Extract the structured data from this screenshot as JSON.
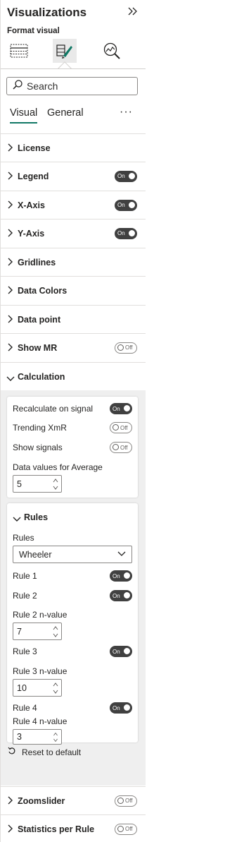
{
  "header": {
    "title": "Visualizations",
    "subtitle": "Format visual",
    "icons": [
      "table-icon",
      "format-paintbrush-icon",
      "analytics-icon"
    ]
  },
  "search": {
    "placeholder": "Search"
  },
  "tabs": {
    "visual": "Visual",
    "general": "General",
    "more": "···"
  },
  "sections": {
    "license": {
      "label": "License"
    },
    "legend": {
      "label": "Legend",
      "toggle": "On"
    },
    "xaxis": {
      "label": "X-Axis",
      "toggle": "On"
    },
    "yaxis": {
      "label": "Y-Axis",
      "toggle": "On"
    },
    "gridlines": {
      "label": "Gridlines"
    },
    "datacolors": {
      "label": "Data Colors"
    },
    "datapoint": {
      "label": "Data point"
    },
    "showmr": {
      "label": "Show MR",
      "toggle": "Off"
    },
    "calculation": {
      "label": "Calculation"
    }
  },
  "calculation": {
    "recalc": {
      "label": "Recalculate on signal",
      "toggle": "On"
    },
    "trending": {
      "label": "Trending XmR",
      "toggle": "Off"
    },
    "signals": {
      "label": "Show signals",
      "toggle": "Off"
    },
    "average": {
      "label": "Data values for Average",
      "value": "5"
    }
  },
  "rules": {
    "header": "Rules",
    "dropdown_label": "Rules",
    "dropdown_value": "Wheeler",
    "rule1": {
      "label": "Rule 1",
      "toggle": "On"
    },
    "rule2": {
      "label": "Rule 2",
      "toggle": "On"
    },
    "rule2n": {
      "label": "Rule 2 n-value",
      "value": "7"
    },
    "rule3": {
      "label": "Rule 3",
      "toggle": "On"
    },
    "rule3n": {
      "label": "Rule 3 n-value",
      "value": "10"
    },
    "rule4": {
      "label": "Rule 4",
      "toggle": "On"
    },
    "rule4n": {
      "label": "Rule 4 n-value",
      "value": "3"
    }
  },
  "reset": {
    "label": "Reset to default"
  },
  "bottom": {
    "zoomslider": {
      "label": "Zoomslider",
      "toggle": "Off"
    },
    "statsrule": {
      "label": "Statistics per Rule",
      "toggle": "Off"
    }
  },
  "colors": {
    "accent": "#117865",
    "toggle_on": "#404040"
  }
}
